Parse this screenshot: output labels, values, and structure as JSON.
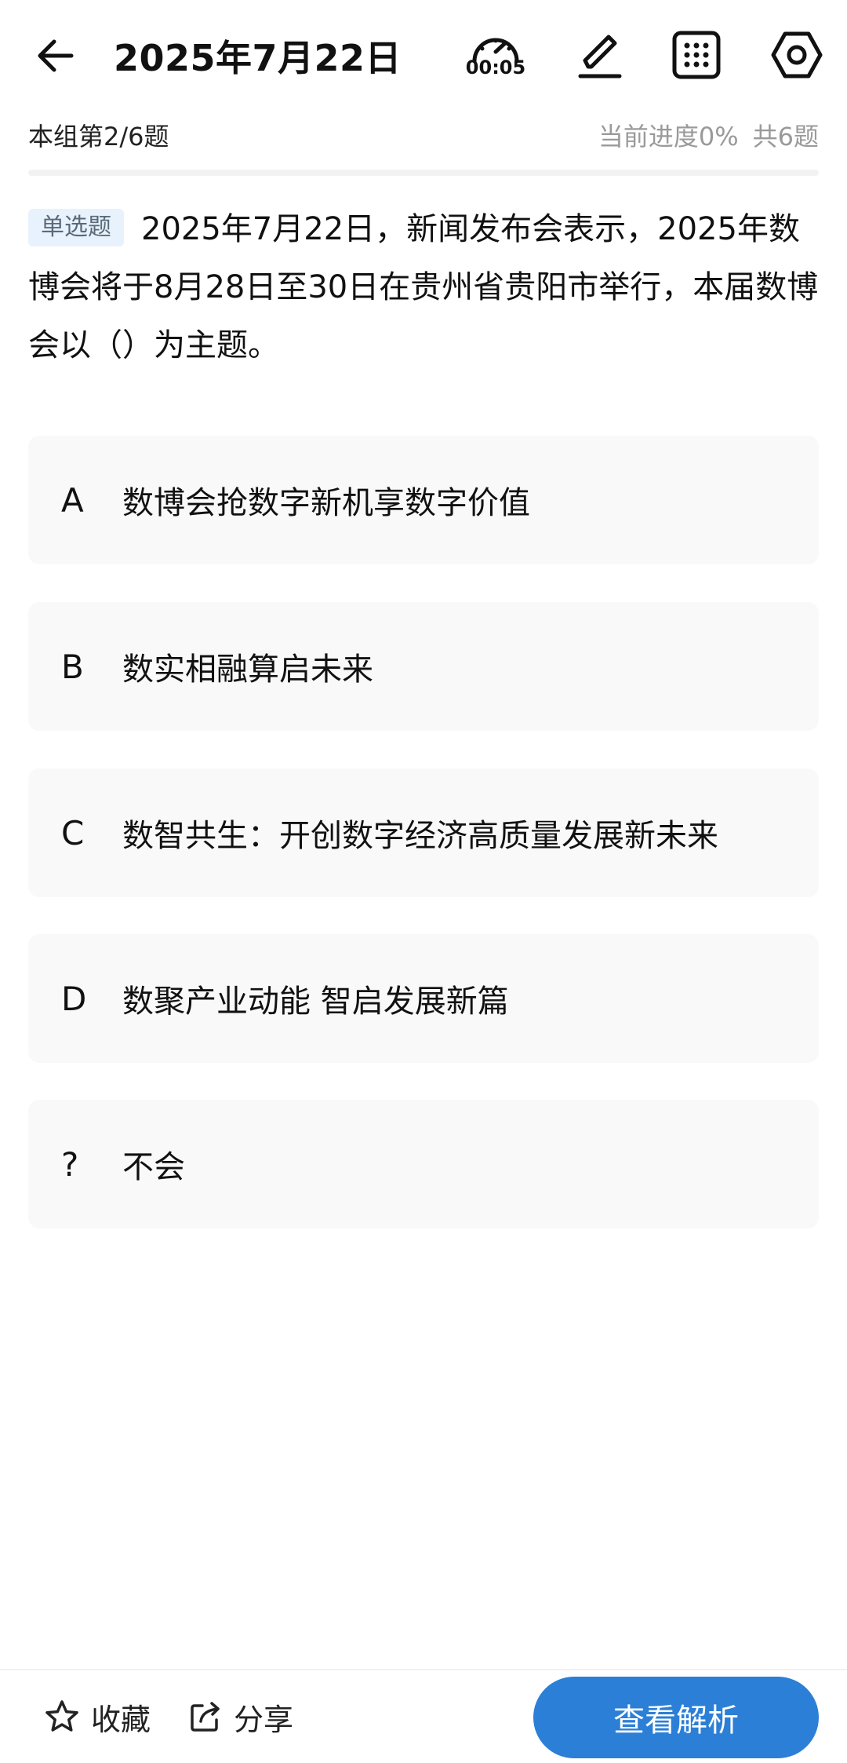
{
  "header": {
    "title": "2025年7月22日",
    "timer": "00:05"
  },
  "subheader": {
    "group_progress": "本组第2/6题",
    "current_progress": "当前进度0%",
    "total": "共6题"
  },
  "question": {
    "type_badge": "单选题",
    "text": "2025年7月22日，新闻发布会表示，2025年数博会将于8月28日至30日在贵州省贵阳市举行，本届数博会以（）为主题。"
  },
  "options": [
    {
      "letter": "A",
      "text": "数博会抢数字新机享数字价值"
    },
    {
      "letter": "B",
      "text": "数实相融算启未来"
    },
    {
      "letter": "C",
      "text": "数智共生：开创数字经济高质量发展新未来"
    },
    {
      "letter": "D",
      "text": "数聚产业动能 智启发展新篇"
    },
    {
      "letter": "?",
      "text": "不会"
    }
  ],
  "bottom": {
    "favorite_label": "收藏",
    "share_label": "分享",
    "analysis_button": "查看解析"
  },
  "colors": {
    "accent": "#2b7fd6",
    "badge_bg": "#e8f2fc",
    "option_bg": "#f9f9f9"
  }
}
